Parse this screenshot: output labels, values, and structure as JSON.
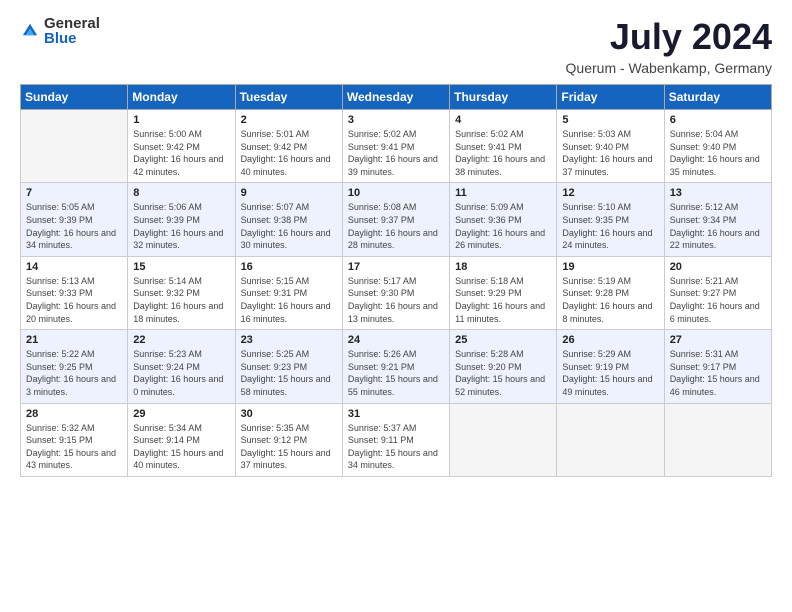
{
  "header": {
    "logo_general": "General",
    "logo_blue": "Blue",
    "month_title": "July 2024",
    "location": "Querum -  Wabenkamp, Germany"
  },
  "weekdays": [
    "Sunday",
    "Monday",
    "Tuesday",
    "Wednesday",
    "Thursday",
    "Friday",
    "Saturday"
  ],
  "weeks": [
    [
      {
        "day": "",
        "sunrise": "",
        "sunset": "",
        "daylight": "",
        "empty": true
      },
      {
        "day": "1",
        "sunrise": "Sunrise: 5:00 AM",
        "sunset": "Sunset: 9:42 PM",
        "daylight": "Daylight: 16 hours and 42 minutes."
      },
      {
        "day": "2",
        "sunrise": "Sunrise: 5:01 AM",
        "sunset": "Sunset: 9:42 PM",
        "daylight": "Daylight: 16 hours and 40 minutes."
      },
      {
        "day": "3",
        "sunrise": "Sunrise: 5:02 AM",
        "sunset": "Sunset: 9:41 PM",
        "daylight": "Daylight: 16 hours and 39 minutes."
      },
      {
        "day": "4",
        "sunrise": "Sunrise: 5:02 AM",
        "sunset": "Sunset: 9:41 PM",
        "daylight": "Daylight: 16 hours and 38 minutes."
      },
      {
        "day": "5",
        "sunrise": "Sunrise: 5:03 AM",
        "sunset": "Sunset: 9:40 PM",
        "daylight": "Daylight: 16 hours and 37 minutes."
      },
      {
        "day": "6",
        "sunrise": "Sunrise: 5:04 AM",
        "sunset": "Sunset: 9:40 PM",
        "daylight": "Daylight: 16 hours and 35 minutes."
      }
    ],
    [
      {
        "day": "7",
        "sunrise": "Sunrise: 5:05 AM",
        "sunset": "Sunset: 9:39 PM",
        "daylight": "Daylight: 16 hours and 34 minutes."
      },
      {
        "day": "8",
        "sunrise": "Sunrise: 5:06 AM",
        "sunset": "Sunset: 9:39 PM",
        "daylight": "Daylight: 16 hours and 32 minutes."
      },
      {
        "day": "9",
        "sunrise": "Sunrise: 5:07 AM",
        "sunset": "Sunset: 9:38 PM",
        "daylight": "Daylight: 16 hours and 30 minutes."
      },
      {
        "day": "10",
        "sunrise": "Sunrise: 5:08 AM",
        "sunset": "Sunset: 9:37 PM",
        "daylight": "Daylight: 16 hours and 28 minutes."
      },
      {
        "day": "11",
        "sunrise": "Sunrise: 5:09 AM",
        "sunset": "Sunset: 9:36 PM",
        "daylight": "Daylight: 16 hours and 26 minutes."
      },
      {
        "day": "12",
        "sunrise": "Sunrise: 5:10 AM",
        "sunset": "Sunset: 9:35 PM",
        "daylight": "Daylight: 16 hours and 24 minutes."
      },
      {
        "day": "13",
        "sunrise": "Sunrise: 5:12 AM",
        "sunset": "Sunset: 9:34 PM",
        "daylight": "Daylight: 16 hours and 22 minutes."
      }
    ],
    [
      {
        "day": "14",
        "sunrise": "Sunrise: 5:13 AM",
        "sunset": "Sunset: 9:33 PM",
        "daylight": "Daylight: 16 hours and 20 minutes."
      },
      {
        "day": "15",
        "sunrise": "Sunrise: 5:14 AM",
        "sunset": "Sunset: 9:32 PM",
        "daylight": "Daylight: 16 hours and 18 minutes."
      },
      {
        "day": "16",
        "sunrise": "Sunrise: 5:15 AM",
        "sunset": "Sunset: 9:31 PM",
        "daylight": "Daylight: 16 hours and 16 minutes."
      },
      {
        "day": "17",
        "sunrise": "Sunrise: 5:17 AM",
        "sunset": "Sunset: 9:30 PM",
        "daylight": "Daylight: 16 hours and 13 minutes."
      },
      {
        "day": "18",
        "sunrise": "Sunrise: 5:18 AM",
        "sunset": "Sunset: 9:29 PM",
        "daylight": "Daylight: 16 hours and 11 minutes."
      },
      {
        "day": "19",
        "sunrise": "Sunrise: 5:19 AM",
        "sunset": "Sunset: 9:28 PM",
        "daylight": "Daylight: 16 hours and 8 minutes."
      },
      {
        "day": "20",
        "sunrise": "Sunrise: 5:21 AM",
        "sunset": "Sunset: 9:27 PM",
        "daylight": "Daylight: 16 hours and 6 minutes."
      }
    ],
    [
      {
        "day": "21",
        "sunrise": "Sunrise: 5:22 AM",
        "sunset": "Sunset: 9:25 PM",
        "daylight": "Daylight: 16 hours and 3 minutes."
      },
      {
        "day": "22",
        "sunrise": "Sunrise: 5:23 AM",
        "sunset": "Sunset: 9:24 PM",
        "daylight": "Daylight: 16 hours and 0 minutes."
      },
      {
        "day": "23",
        "sunrise": "Sunrise: 5:25 AM",
        "sunset": "Sunset: 9:23 PM",
        "daylight": "Daylight: 15 hours and 58 minutes."
      },
      {
        "day": "24",
        "sunrise": "Sunrise: 5:26 AM",
        "sunset": "Sunset: 9:21 PM",
        "daylight": "Daylight: 15 hours and 55 minutes."
      },
      {
        "day": "25",
        "sunrise": "Sunrise: 5:28 AM",
        "sunset": "Sunset: 9:20 PM",
        "daylight": "Daylight: 15 hours and 52 minutes."
      },
      {
        "day": "26",
        "sunrise": "Sunrise: 5:29 AM",
        "sunset": "Sunset: 9:19 PM",
        "daylight": "Daylight: 15 hours and 49 minutes."
      },
      {
        "day": "27",
        "sunrise": "Sunrise: 5:31 AM",
        "sunset": "Sunset: 9:17 PM",
        "daylight": "Daylight: 15 hours and 46 minutes."
      }
    ],
    [
      {
        "day": "28",
        "sunrise": "Sunrise: 5:32 AM",
        "sunset": "Sunset: 9:15 PM",
        "daylight": "Daylight: 15 hours and 43 minutes."
      },
      {
        "day": "29",
        "sunrise": "Sunrise: 5:34 AM",
        "sunset": "Sunset: 9:14 PM",
        "daylight": "Daylight: 15 hours and 40 minutes."
      },
      {
        "day": "30",
        "sunrise": "Sunrise: 5:35 AM",
        "sunset": "Sunset: 9:12 PM",
        "daylight": "Daylight: 15 hours and 37 minutes."
      },
      {
        "day": "31",
        "sunrise": "Sunrise: 5:37 AM",
        "sunset": "Sunset: 9:11 PM",
        "daylight": "Daylight: 15 hours and 34 minutes."
      },
      {
        "day": "",
        "sunrise": "",
        "sunset": "",
        "daylight": "",
        "empty": true
      },
      {
        "day": "",
        "sunrise": "",
        "sunset": "",
        "daylight": "",
        "empty": true
      },
      {
        "day": "",
        "sunrise": "",
        "sunset": "",
        "daylight": "",
        "empty": true
      }
    ]
  ]
}
